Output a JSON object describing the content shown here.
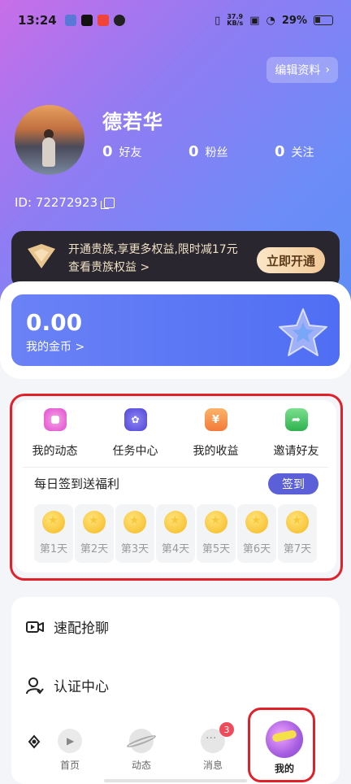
{
  "status_bar": {
    "time": "13:24",
    "net_speed_value": "37.9",
    "net_speed_unit": "KB/s",
    "battery": "29%"
  },
  "profile": {
    "edit_label": "编辑资料",
    "name": "德若华",
    "friends_count": "0",
    "friends_label": "好友",
    "fans_count": "0",
    "fans_label": "粉丝",
    "follow_count": "0",
    "follow_label": "关注",
    "id_text": "ID: 72272923"
  },
  "vip": {
    "line1": "开通贵族,享更多权益,限时减17元",
    "line2": "查看贵族权益 >",
    "button": "立即开通"
  },
  "coins": {
    "amount": "0.00",
    "label": "我的金币 >"
  },
  "functions": {
    "items": [
      {
        "label": "我的动态",
        "icon": "dynamic-icon",
        "color": "#e04ad0"
      },
      {
        "label": "任务中心",
        "icon": "task-icon",
        "color": "#6a5be8"
      },
      {
        "label": "我的收益",
        "icon": "income-icon",
        "color": "#f37a3a"
      },
      {
        "label": "邀请好友",
        "icon": "invite-icon",
        "color": "#3bbf5b"
      }
    ],
    "signin_title": "每日签到送福利",
    "signin_button": "签到",
    "days": [
      "第1天",
      "第2天",
      "第3天",
      "第4天",
      "第5天",
      "第6天",
      "第7天"
    ]
  },
  "menu": {
    "items": [
      {
        "label": "速配抢聊",
        "icon": "video-icon"
      },
      {
        "label": "认证中心",
        "icon": "user-verify-icon"
      }
    ]
  },
  "tabbar": {
    "tabs": [
      {
        "label": "首页",
        "icon": "home-play-icon"
      },
      {
        "label": "动态",
        "icon": "planet-icon"
      },
      {
        "label": "消息",
        "icon": "chat-icon",
        "badge": "3"
      },
      {
        "label": "我的",
        "icon": "me-icon"
      }
    ]
  },
  "colors": {
    "accent": "#5b5fd8",
    "highlight_outline": "#e2202a",
    "coin_card": "#4f6ef3"
  }
}
